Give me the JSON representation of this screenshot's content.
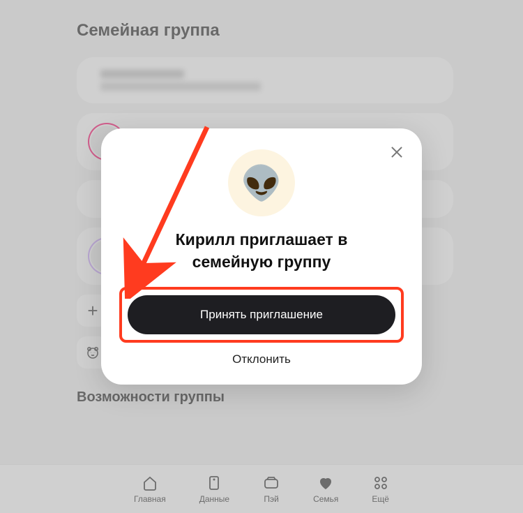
{
  "page": {
    "title": "Семейная группа",
    "section2": "Возможности группы"
  },
  "modal": {
    "emoji": "👽",
    "title": "Кирилл приглашает в семейную группу",
    "accept": "Принять приглашение",
    "decline": "Отклонить"
  },
  "tabs": {
    "home": "Главная",
    "data": "Данные",
    "pay": "Пэй",
    "family": "Семья",
    "more": "Ещё"
  }
}
